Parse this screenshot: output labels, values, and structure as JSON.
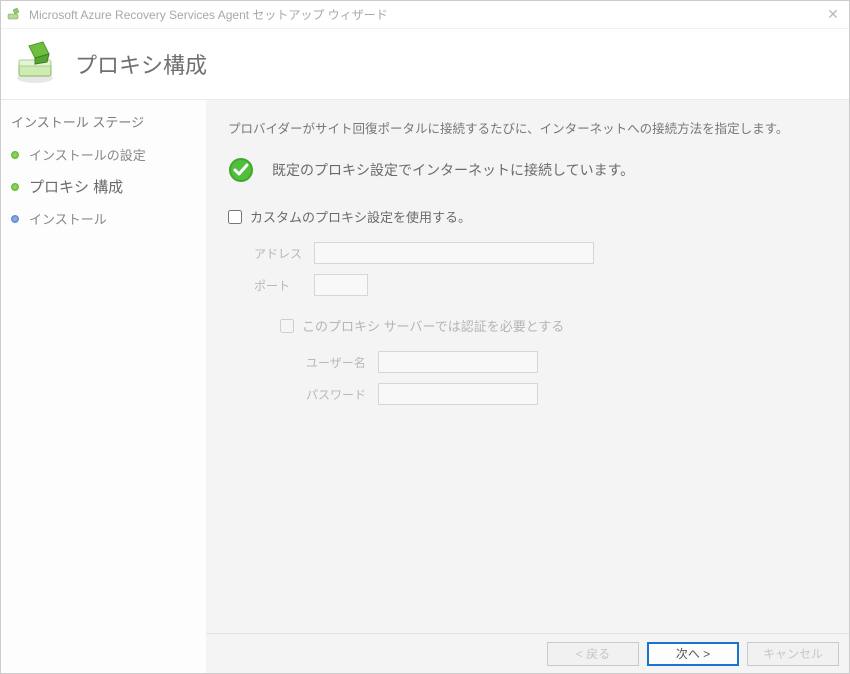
{
  "window": {
    "title": "Microsoft Azure Recovery Services Agent セットアップ ウィザード"
  },
  "header": {
    "title": "プロキシ構成"
  },
  "sidebar": {
    "header": "インストール ステージ",
    "items": [
      {
        "label": "インストールの設定",
        "dot": "green"
      },
      {
        "label": "プロキシ 構成",
        "dot": "green",
        "current": true
      },
      {
        "label": "インストール",
        "dot": "blue"
      }
    ]
  },
  "content": {
    "intro": "プロバイダーがサイト回復ポータルに接続するたびに、インターネットへの接続方法を指定します。",
    "status": "既定のプロキシ設定でインターネットに接続しています。",
    "use_custom_proxy_label": "カスタムのプロキシ設定を使用する。",
    "use_custom_proxy_checked": false,
    "address_label": "アドレス",
    "address_value": "",
    "port_label": "ポート",
    "port_value": "",
    "auth_label": "このプロキシ サーバーでは認証を必要とする",
    "auth_checked": false,
    "username_label": "ユーザー名",
    "username_value": "",
    "password_label": "パスワード",
    "password_value": ""
  },
  "footer": {
    "back_label": "< 戻る",
    "next_label": "次へ >",
    "cancel_label": "キャンセル"
  },
  "colors": {
    "accent": "#1b73d0",
    "green_ok": "#3fa82c"
  }
}
